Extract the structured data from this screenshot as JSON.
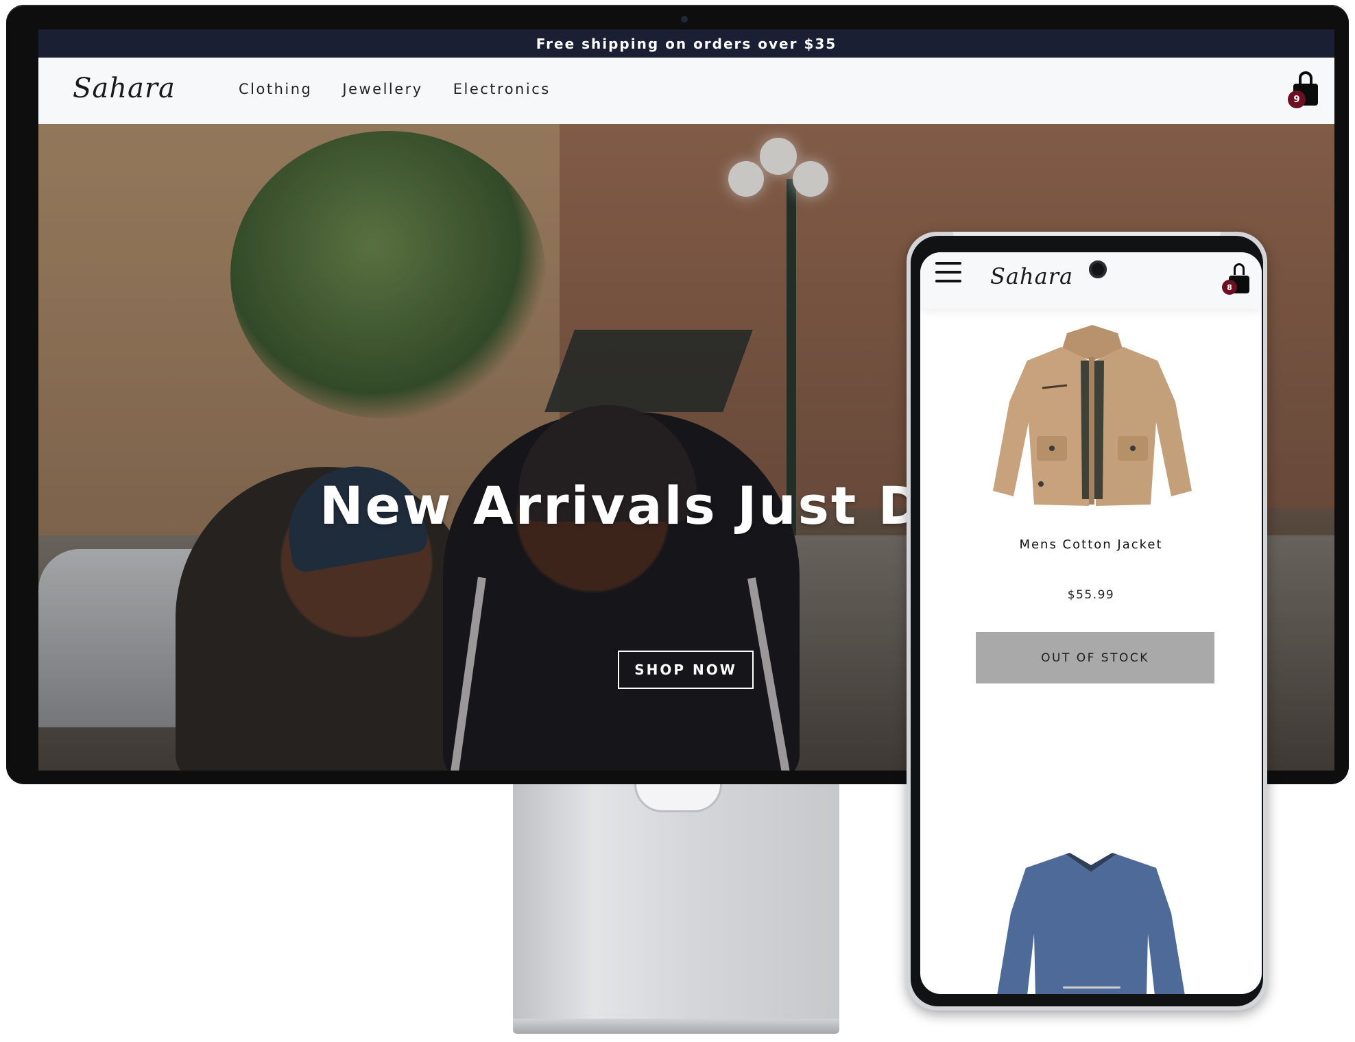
{
  "promo_bar": {
    "text": "Free shipping on orders over $35"
  },
  "desktop": {
    "logo": "Sahara",
    "nav_links": [
      "Clothing",
      "Jewellery",
      "Electronics"
    ],
    "cart": {
      "icon": "shopping-bag-icon",
      "count": "9"
    },
    "hero": {
      "title": "New Arrivals Just Dro",
      "cta": "SHOP NOW"
    }
  },
  "mobile": {
    "logo": "Sahara",
    "menu_icon": "hamburger-menu-icon",
    "cart": {
      "icon": "shopping-bag-icon",
      "count": "8"
    },
    "products": [
      {
        "name": "Mens Cotton Jacket",
        "price": "$55.99",
        "button": "OUT OF STOCK",
        "image": "tan-cotton-jacket"
      },
      {
        "image": "blue-long-sleeve-shirt"
      }
    ]
  },
  "colors": {
    "promo_bar_bg": "#1b1f33",
    "badge": "#6b0f22",
    "out_of_stock_button": "#a9a9a9",
    "nav_bg": "#f7f8fa"
  }
}
